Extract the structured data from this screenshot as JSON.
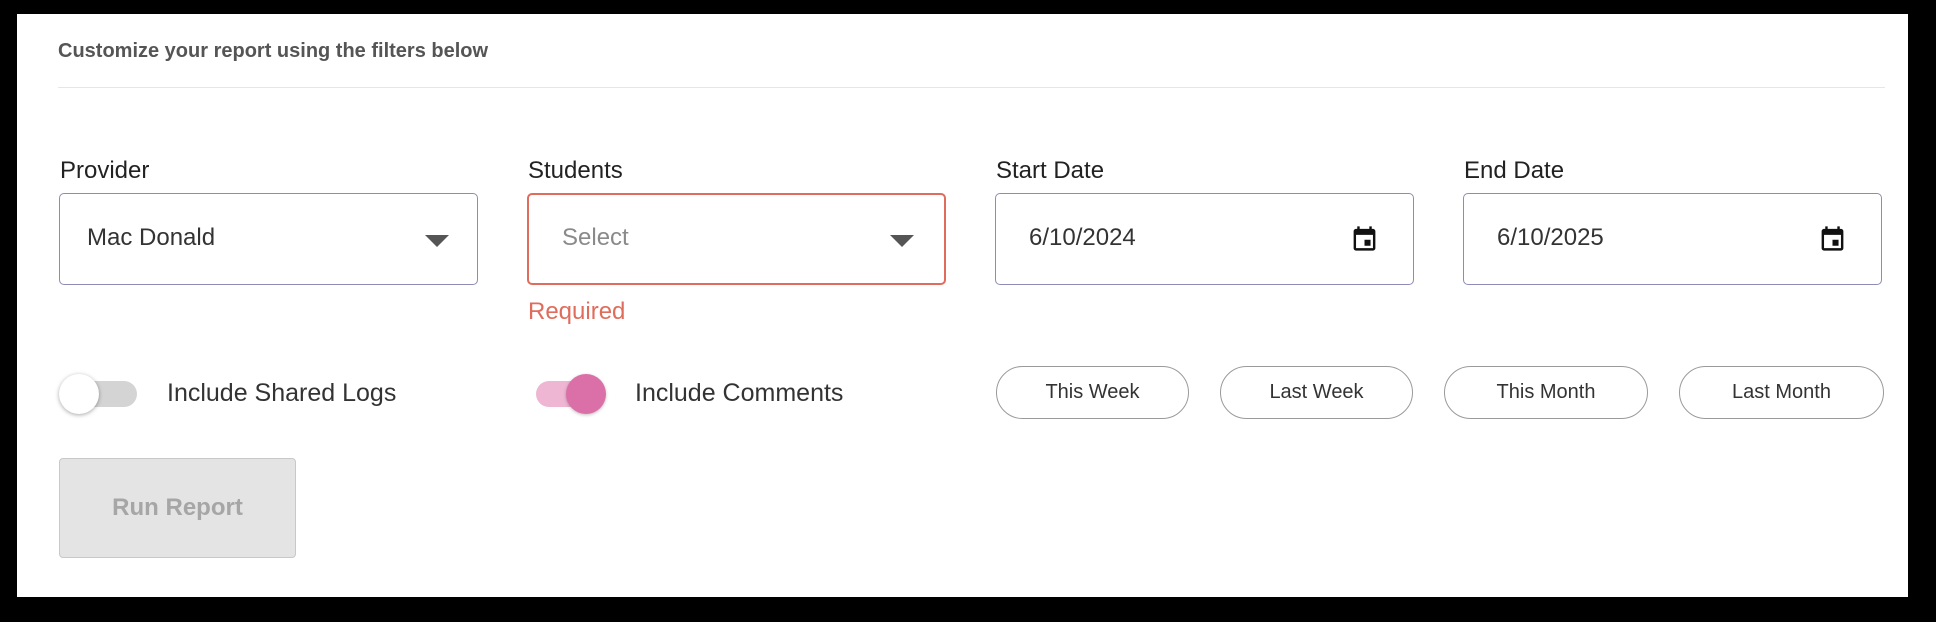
{
  "header": {
    "title": "Customize your report using the filters below"
  },
  "filters": {
    "provider": {
      "label": "Provider",
      "value": "Mac Donald"
    },
    "students": {
      "label": "Students",
      "placeholder": "Select",
      "error": "Required"
    },
    "start_date": {
      "label": "Start Date",
      "value": "6/10/2024"
    },
    "end_date": {
      "label": "End Date",
      "value": "6/10/2025"
    }
  },
  "toggles": [
    {
      "label": "Include Shared Logs",
      "on": false
    },
    {
      "label": "Include Comments",
      "on": true
    }
  ],
  "quick_ranges": [
    "This Week",
    "Last Week",
    "This Month",
    "Last Month"
  ],
  "actions": {
    "run_report": "Run Report"
  },
  "colors": {
    "error": "#e06c5b",
    "toggle_on": "#db6fa7",
    "field_border": "#8e8cb6"
  },
  "icons": {
    "dropdown": "caret-down-icon",
    "date": "calendar-icon"
  }
}
